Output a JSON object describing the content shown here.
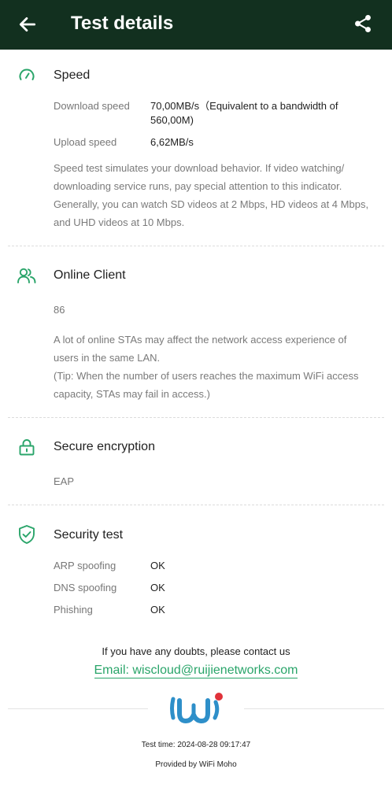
{
  "header": {
    "title": "Test details",
    "back_icon": "arrow-left-icon",
    "share_icon": "share-icon"
  },
  "speed": {
    "title": "Speed",
    "icon": "speedometer-icon",
    "download_label": "Download speed",
    "download_value_line1": "70,00MB/s（Equivalent to a bandwidth of",
    "download_value_line2": "560,00M)",
    "upload_label": "Upload speed",
    "upload_value": "6,62MB/s",
    "desc": [
      "Speed test simulates your download behavior. If video watching/",
      "downloading service runs, pay special attention to this indicator.",
      "Generally, you can watch SD videos at 2 Mbps, HD videos at 4 Mbps,",
      "and UHD videos at 10 Mbps."
    ]
  },
  "clients": {
    "title": "Online Client",
    "icon": "users-icon",
    "count": "86",
    "desc": [
      "A lot of online STAs may affect the network access experience of",
      "users in the same LAN.",
      "(Tip: When the number of users reaches the maximum WiFi access",
      "capacity, STAs may fail in access.)"
    ]
  },
  "encryption": {
    "title": "Secure encryption",
    "icon": "lock-icon",
    "value": "EAP"
  },
  "security": {
    "title": "Security test",
    "icon": "shield-check-icon",
    "rows": [
      {
        "label": "ARP spoofing",
        "value": "OK"
      },
      {
        "label": "DNS spoofing",
        "value": "OK"
      },
      {
        "label": "Phishing",
        "value": "OK"
      }
    ]
  },
  "contact": {
    "text": "If you have any doubts, please contact us",
    "email": "Email: wiscloud@ruijienetworks.com"
  },
  "footer": {
    "logo": "wifi-moho-logo",
    "test_time": "Test time: 2024-08-28 09:17:47",
    "provided_by": "Provided by WiFi Moho"
  },
  "colors": {
    "header_bg": "#12301f",
    "accent": "#2aa56a",
    "logo_blue": "#2e8fc9",
    "logo_red": "#e0323a"
  }
}
